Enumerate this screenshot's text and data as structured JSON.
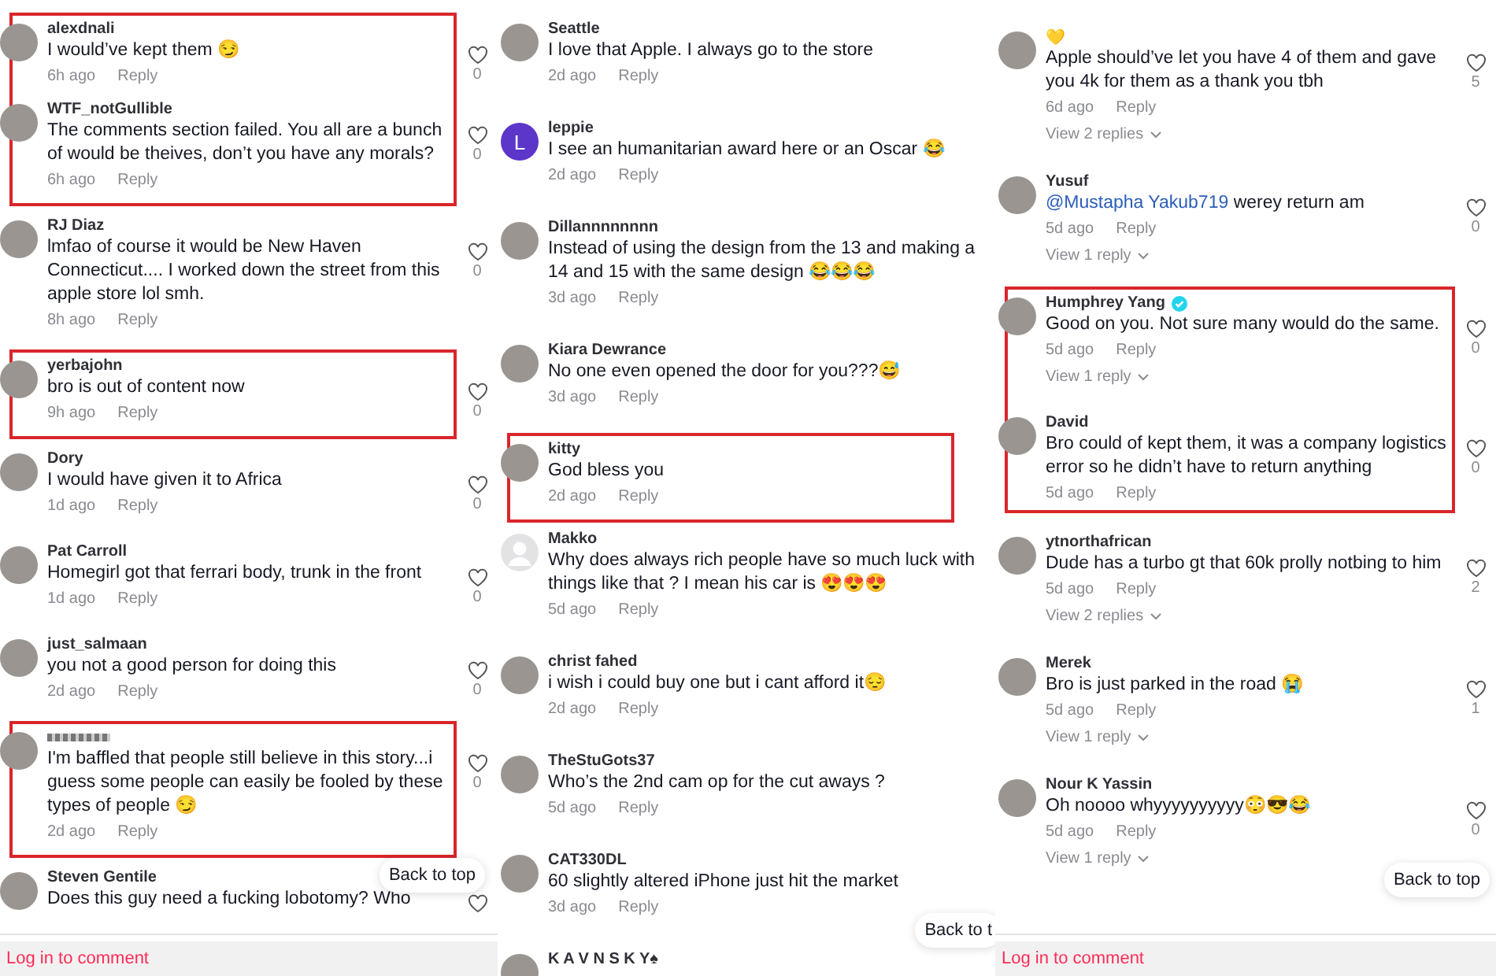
{
  "panels": [
    {
      "comments": [
        {
          "user": "alexdnali",
          "verified": false,
          "highlighted": true,
          "avatar": {
            "kind": "photo"
          },
          "text": "I would’ve kept them 😏",
          "time": "6h ago",
          "reply": "Reply",
          "heart": true,
          "likes": "0"
        },
        {
          "user": "WTF_notGullible",
          "verified": false,
          "highlighted": true,
          "avatar": {
            "kind": "photo"
          },
          "text": "The comments section failed. You all are a bunch of would be theives, don’t you have any morals?",
          "time": "6h ago",
          "reply": "Reply",
          "heart": true,
          "likes": "0"
        },
        {
          "user": "RJ Diaz",
          "verified": false,
          "highlighted": false,
          "avatar": {
            "kind": "photo"
          },
          "text": "lmfao of course it would be New Haven Connecticut.... I worked down the street from this apple store lol smh.",
          "time": "8h ago",
          "reply": "Reply",
          "heart": true,
          "likes": "0"
        },
        {
          "user": "yerbajohn",
          "verified": false,
          "highlighted": true,
          "avatar": {
            "kind": "photo"
          },
          "text": "bro is out of content now",
          "time": "9h ago",
          "reply": "Reply",
          "heart": true,
          "likes": "0"
        },
        {
          "user": "Dory",
          "verified": false,
          "highlighted": false,
          "avatar": {
            "kind": "photo"
          },
          "text": "I would have given it to Africa",
          "time": "1d ago",
          "reply": "Reply",
          "heart": true,
          "likes": "0"
        },
        {
          "user": "Pat Carroll",
          "verified": false,
          "highlighted": false,
          "avatar": {
            "kind": "photo"
          },
          "text": "Homegirl got that ferrari body, trunk in the front",
          "time": "1d ago",
          "reply": "Reply",
          "heart": true,
          "likes": "0"
        },
        {
          "user": "just_salmaan",
          "verified": false,
          "highlighted": false,
          "avatar": {
            "kind": "photo"
          },
          "text": "you not a good person for doing this",
          "time": "2d ago",
          "reply": "Reply",
          "heart": true,
          "likes": "0"
        },
        {
          "name_redacted": true,
          "verified": false,
          "highlighted": true,
          "avatar": {
            "kind": "photo"
          },
          "text": "I'm baffled that people still believe in this story...i guess some people can easily be fooled by these types of people 😏",
          "time": "2d ago",
          "reply": "Reply",
          "heart": true,
          "likes": "0"
        },
        {
          "user": "Steven Gentile",
          "verified": false,
          "highlighted": false,
          "avatar": {
            "kind": "photo"
          },
          "text": "Does this guy need a fucking lobotomy? Who",
          "heart": true
        }
      ],
      "back_to_top": "Back to top",
      "login_bar": "Log in to comment"
    },
    {
      "comments": [
        {
          "user": "Seattle",
          "verified": false,
          "highlighted": false,
          "avatar": {
            "kind": "photo"
          },
          "text": "I love that Apple. I always go to the store",
          "time": "2d ago",
          "reply": "Reply",
          "heart": false
        },
        {
          "user": "leppie",
          "verified": false,
          "highlighted": false,
          "avatar": {
            "kind": "letter",
            "letter": "L",
            "color": "#5b36c9"
          },
          "text": "I see an humanitarian award here or an Oscar 😂",
          "time": "2d ago",
          "reply": "Reply",
          "heart": false
        },
        {
          "user": "Dillannnnnnnn",
          "verified": false,
          "highlighted": false,
          "avatar": {
            "kind": "photo"
          },
          "text": "Instead of using the design from the 13 and making a 14 and 15 with the same design 😂😂😂",
          "time": "3d ago",
          "reply": "Reply",
          "heart": false
        },
        {
          "user": "Kiara Dewrance",
          "verified": false,
          "highlighted": false,
          "avatar": {
            "kind": "photo"
          },
          "text": "No one even opened the door for you???😅",
          "time": "3d ago",
          "reply": "Reply",
          "heart": false
        },
        {
          "user": "kitty",
          "verified": false,
          "highlighted": true,
          "avatar": {
            "kind": "photo"
          },
          "text": "God bless you",
          "time": "2d ago",
          "reply": "Reply",
          "heart": false
        },
        {
          "user": "Makko",
          "verified": false,
          "highlighted": false,
          "avatar": {
            "kind": "default"
          },
          "text": "Why does always rich people have so much luck with things like that ? I mean his car is 😍😍😍",
          "time": "5d ago",
          "reply": "Reply",
          "heart": false
        },
        {
          "user": "christ fahed",
          "verified": false,
          "highlighted": false,
          "avatar": {
            "kind": "photo"
          },
          "text": "i wish i could buy one but i cant afford it😔",
          "time": "2d ago",
          "reply": "Reply",
          "heart": false
        },
        {
          "user": "TheStuGots37",
          "verified": false,
          "highlighted": false,
          "avatar": {
            "kind": "photo"
          },
          "text": "Who’s the 2nd cam op for the cut aways ?",
          "time": "5d ago",
          "reply": "Reply",
          "heart": false
        },
        {
          "user": "CAT330DL",
          "verified": false,
          "highlighted": false,
          "avatar": {
            "kind": "photo"
          },
          "text": "60 slightly altered iPhone just hit the market",
          "time": "3d ago",
          "reply": "Reply",
          "heart": false
        },
        {
          "user": "K A V N S K Y♠",
          "verified": false,
          "highlighted": false,
          "avatar": {
            "kind": "photo"
          }
        }
      ],
      "back_to_top": "Back to t"
    },
    {
      "comments": [
        {
          "user": "💛",
          "verified": false,
          "highlighted": false,
          "avatar": {
            "kind": "photo"
          },
          "text": "Apple should’ve let you have 4 of them and gave you 4k for them as a thank you tbh",
          "time": "6d ago",
          "reply": "Reply",
          "replies": "View 2 replies",
          "heart": true,
          "likes": "5"
        },
        {
          "user": "Yusuf",
          "verified": false,
          "highlighted": false,
          "avatar": {
            "kind": "photo"
          },
          "mention": "@Mustapha Yakub719",
          "text": "werey return am",
          "time": "5d ago",
          "reply": "Reply",
          "replies": "View 1 reply",
          "heart": true,
          "likes": "0"
        },
        {
          "user": "Humphrey Yang",
          "verified": true,
          "highlighted": true,
          "avatar": {
            "kind": "photo"
          },
          "text": "Good on you. Not sure many would do the same.",
          "time": "5d ago",
          "reply": "Reply",
          "replies": "View 1 reply",
          "heart": true,
          "likes": "0"
        },
        {
          "user": "David",
          "verified": false,
          "highlighted": true,
          "avatar": {
            "kind": "photo"
          },
          "text": "Bro could of kept them, it was a company logistics error so he didn’t have to return anything",
          "time": "5d ago",
          "reply": "Reply",
          "heart": true,
          "likes": "0"
        },
        {
          "user": "ytnorthafrican",
          "verified": false,
          "highlighted": false,
          "avatar": {
            "kind": "photo"
          },
          "text": "Dude has a turbo gt that 60k prolly notbing to him",
          "time": "5d ago",
          "reply": "Reply",
          "replies": "View 2 replies",
          "heart": true,
          "likes": "2"
        },
        {
          "user": "Merek",
          "verified": false,
          "highlighted": false,
          "avatar": {
            "kind": "photo"
          },
          "text": "Bro is just parked in the road 😭",
          "time": "5d ago",
          "reply": "Reply",
          "replies": "View 1 reply",
          "heart": true,
          "likes": "1"
        },
        {
          "user": "Nour K Yassin",
          "verified": false,
          "highlighted": false,
          "avatar": {
            "kind": "photo"
          },
          "text": "Oh noooo whyyyyyyyyyy😳😎😂",
          "time": "5d ago",
          "reply": "Reply",
          "replies": "View 1 reply",
          "heart": true,
          "likes": "0"
        }
      ],
      "back_to_top": "Back to top",
      "login_bar": "Log in to comment"
    }
  ]
}
